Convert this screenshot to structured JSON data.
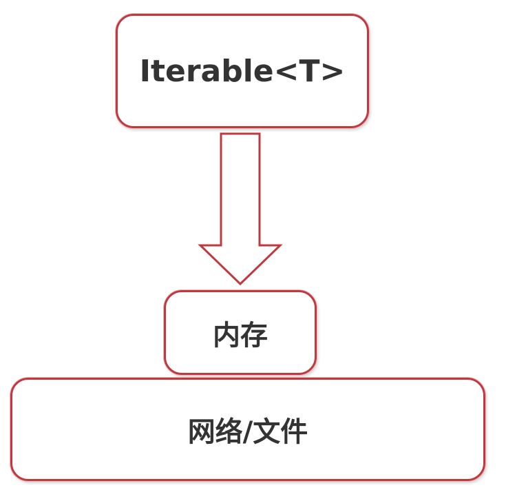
{
  "diagram": {
    "top_box": {
      "label": "Iterable<T>"
    },
    "middle_box": {
      "label": "内存"
    },
    "bottom_box": {
      "label": "网络/文件"
    }
  },
  "colors": {
    "border": "#c0393f",
    "text": "#333333",
    "background": "#ffffff"
  }
}
